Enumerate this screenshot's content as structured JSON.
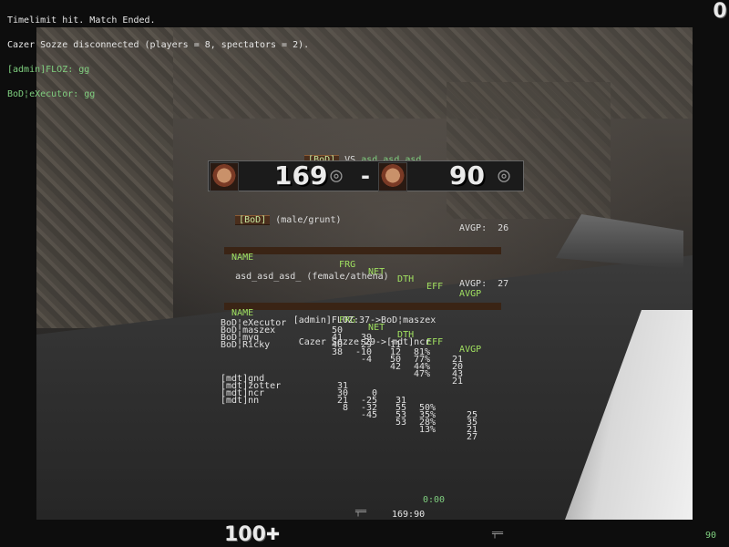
{
  "console": [
    {
      "text": "Timelimit hit. Match Ended.",
      "color": "white"
    },
    {
      "text": "Cazer Sozze disconnected (players = 8, spectators = 2).",
      "color": "white"
    },
    {
      "text": "[admin]FLOZ: gg",
      "color": "green"
    },
    {
      "text": "BoD¦eXecutor: gg",
      "color": "green"
    }
  ],
  "frag_count": "0",
  "match": {
    "team1": "[BoD]",
    "vs": "VS",
    "team2": "asd_asd_asd_",
    "score1": "169",
    "score2": "90",
    "dash": "-"
  },
  "teams": [
    {
      "header_name": "[BoD]",
      "header_model": "(male/grunt)",
      "avgp_label": "AVGP:",
      "avgp": "26",
      "columns": [
        "NAME",
        "FRG",
        "NET",
        "DTH",
        "EFF",
        "AVGP"
      ],
      "players": [
        {
          "name": "BoD¦eXecutor",
          "frg": "50",
          "net": "39",
          "dth": "11",
          "eff": "81%",
          "avgp": "21"
        },
        {
          "name": "BoD¦maszex",
          "frg": "41",
          "net": "29",
          "dth": "12",
          "eff": "77%",
          "avgp": "20"
        },
        {
          "name": "BoD¦myq",
          "frg": "40",
          "net": "-10",
          "dth": "50",
          "eff": "44%",
          "avgp": "43"
        },
        {
          "name": "BoD¦Ricky",
          "frg": "38",
          "net": "-4",
          "dth": "42",
          "eff": "47%",
          "avgp": "21"
        }
      ]
    },
    {
      "header_name": "asd_asd_asd_",
      "header_model": "(female/athena)",
      "avgp_label": "AVGP:",
      "avgp": "27",
      "columns": [
        "NAME",
        "FRG",
        "NET",
        "DTH",
        "EFF",
        "AVGP"
      ],
      "players": [
        {
          "name": "[mdt]gnd",
          "frg": "31",
          "net": "0",
          "dth": "31",
          "eff": "50%",
          "avgp": "25"
        },
        {
          "name": "[mdt]zotter",
          "frg": "30",
          "net": "-25",
          "dth": "55",
          "eff": "35%",
          "avgp": "35"
        },
        {
          "name": "[mdt]ncr",
          "frg": "21",
          "net": "-32",
          "dth": "53",
          "eff": "28%",
          "avgp": "21"
        },
        {
          "name": "[mdt]nn",
          "frg": "8",
          "net": "-45",
          "dth": "53",
          "eff": "13%",
          "avgp": "27"
        }
      ]
    }
  ],
  "events": [
    "[admin]FLOZ:37->BoD¦maszex",
    "Cazer Sozze:29->[mdt]ncr"
  ],
  "hud": {
    "timer": "0:00",
    "team_score": "169:90",
    "health": "100",
    "ammo": "90"
  },
  "colors": {
    "console_green": "#7fcf7f",
    "plaque_brown": "#4a2e1c",
    "header_green": "#a0e060"
  },
  "icons": [
    "quake-logo-icon",
    "player-face-icon",
    "shotgun-icon",
    "health-cross-icon"
  ]
}
